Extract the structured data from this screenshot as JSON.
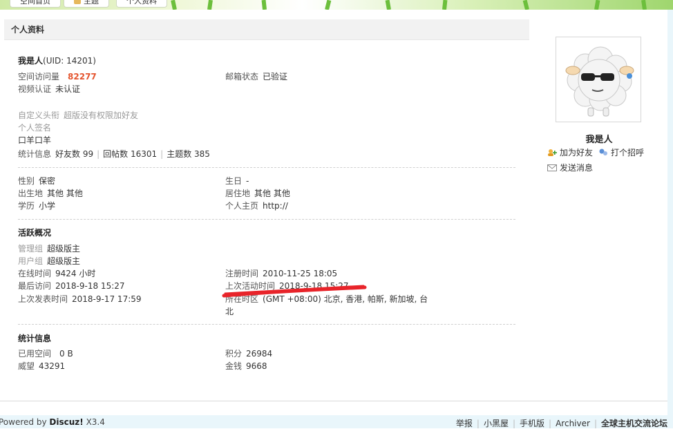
{
  "nav": {
    "tabs": [
      "空间首页",
      "主题",
      "个人资料"
    ]
  },
  "section": {
    "title": "个人资料"
  },
  "profile": {
    "name_line": "我是人",
    "uid_line": "(UID: 14201)",
    "visits_label": "空间访问量",
    "visits_value": "82277",
    "email_label": "邮箱状态",
    "email_value": "已验证",
    "video_label": "视频认证",
    "video_value": "未认证",
    "custom_title_label": "自定义头衔",
    "custom_title_value": "超版没有权限加好友",
    "signature_label": "个人签名",
    "signature_value": "口羊口羊",
    "stats_label": "统计信息",
    "friends": "好友数 99",
    "replies": "回帖数 16301",
    "threads": "主题数 385"
  },
  "personal": {
    "gender_label": "性别",
    "gender_value": "保密",
    "birthday_label": "生日",
    "birthday_value": "-",
    "birthplace_label": "出生地",
    "birthplace_value": "其他 其他",
    "residence_label": "居住地",
    "residence_value": "其他 其他",
    "edu_label": "学历",
    "edu_value": "小学",
    "homepage_label": "个人主页",
    "homepage_value": "http://"
  },
  "activity": {
    "title": "活跃概况",
    "admin_group_label": "管理组",
    "admin_group_value": "超级版主",
    "user_group_label": "用户组",
    "user_group_value": "超级版主",
    "online_label": "在线时间",
    "online_value": "9424 小时",
    "register_label": "注册时间",
    "register_value": "2010-11-25 18:05",
    "last_visit_label": "最后访问",
    "last_visit_value": "2018-9-18 15:27",
    "last_active_label": "上次活动时间",
    "last_active_value": "2018-9-18 15:27",
    "last_post_label": "上次发表时间",
    "last_post_value": "2018-9-17 17:59",
    "timezone_label": "所在时区",
    "timezone_value": "(GMT +08:00) 北京, 香港, 帕斯, 新加坡, 台",
    "timezone_value_2": "北"
  },
  "statistics": {
    "title": "统计信息",
    "space_label": "已用空间",
    "space_value": "0 B",
    "credits_label": "积分",
    "credits_value": "26984",
    "prestige_label": "威望",
    "prestige_value": "43291",
    "money_label": "金钱",
    "money_value": "9668"
  },
  "sidebar": {
    "name": "我是人",
    "add_friend": "加为好友",
    "greet": "打个招呼",
    "message": "发送消息"
  },
  "footer": {
    "powered_prefix": "Powered by",
    "powered_brand": "Discuz!",
    "powered_version": "X3.4",
    "links": [
      "举报",
      "小黑屋",
      "手机版",
      "Archiver"
    ],
    "site_name": "全球主机交流论坛"
  },
  "colors": {
    "highlight": "#e4542e",
    "annotation": "#e8242a",
    "footer_bg": "#e9f6fb"
  }
}
